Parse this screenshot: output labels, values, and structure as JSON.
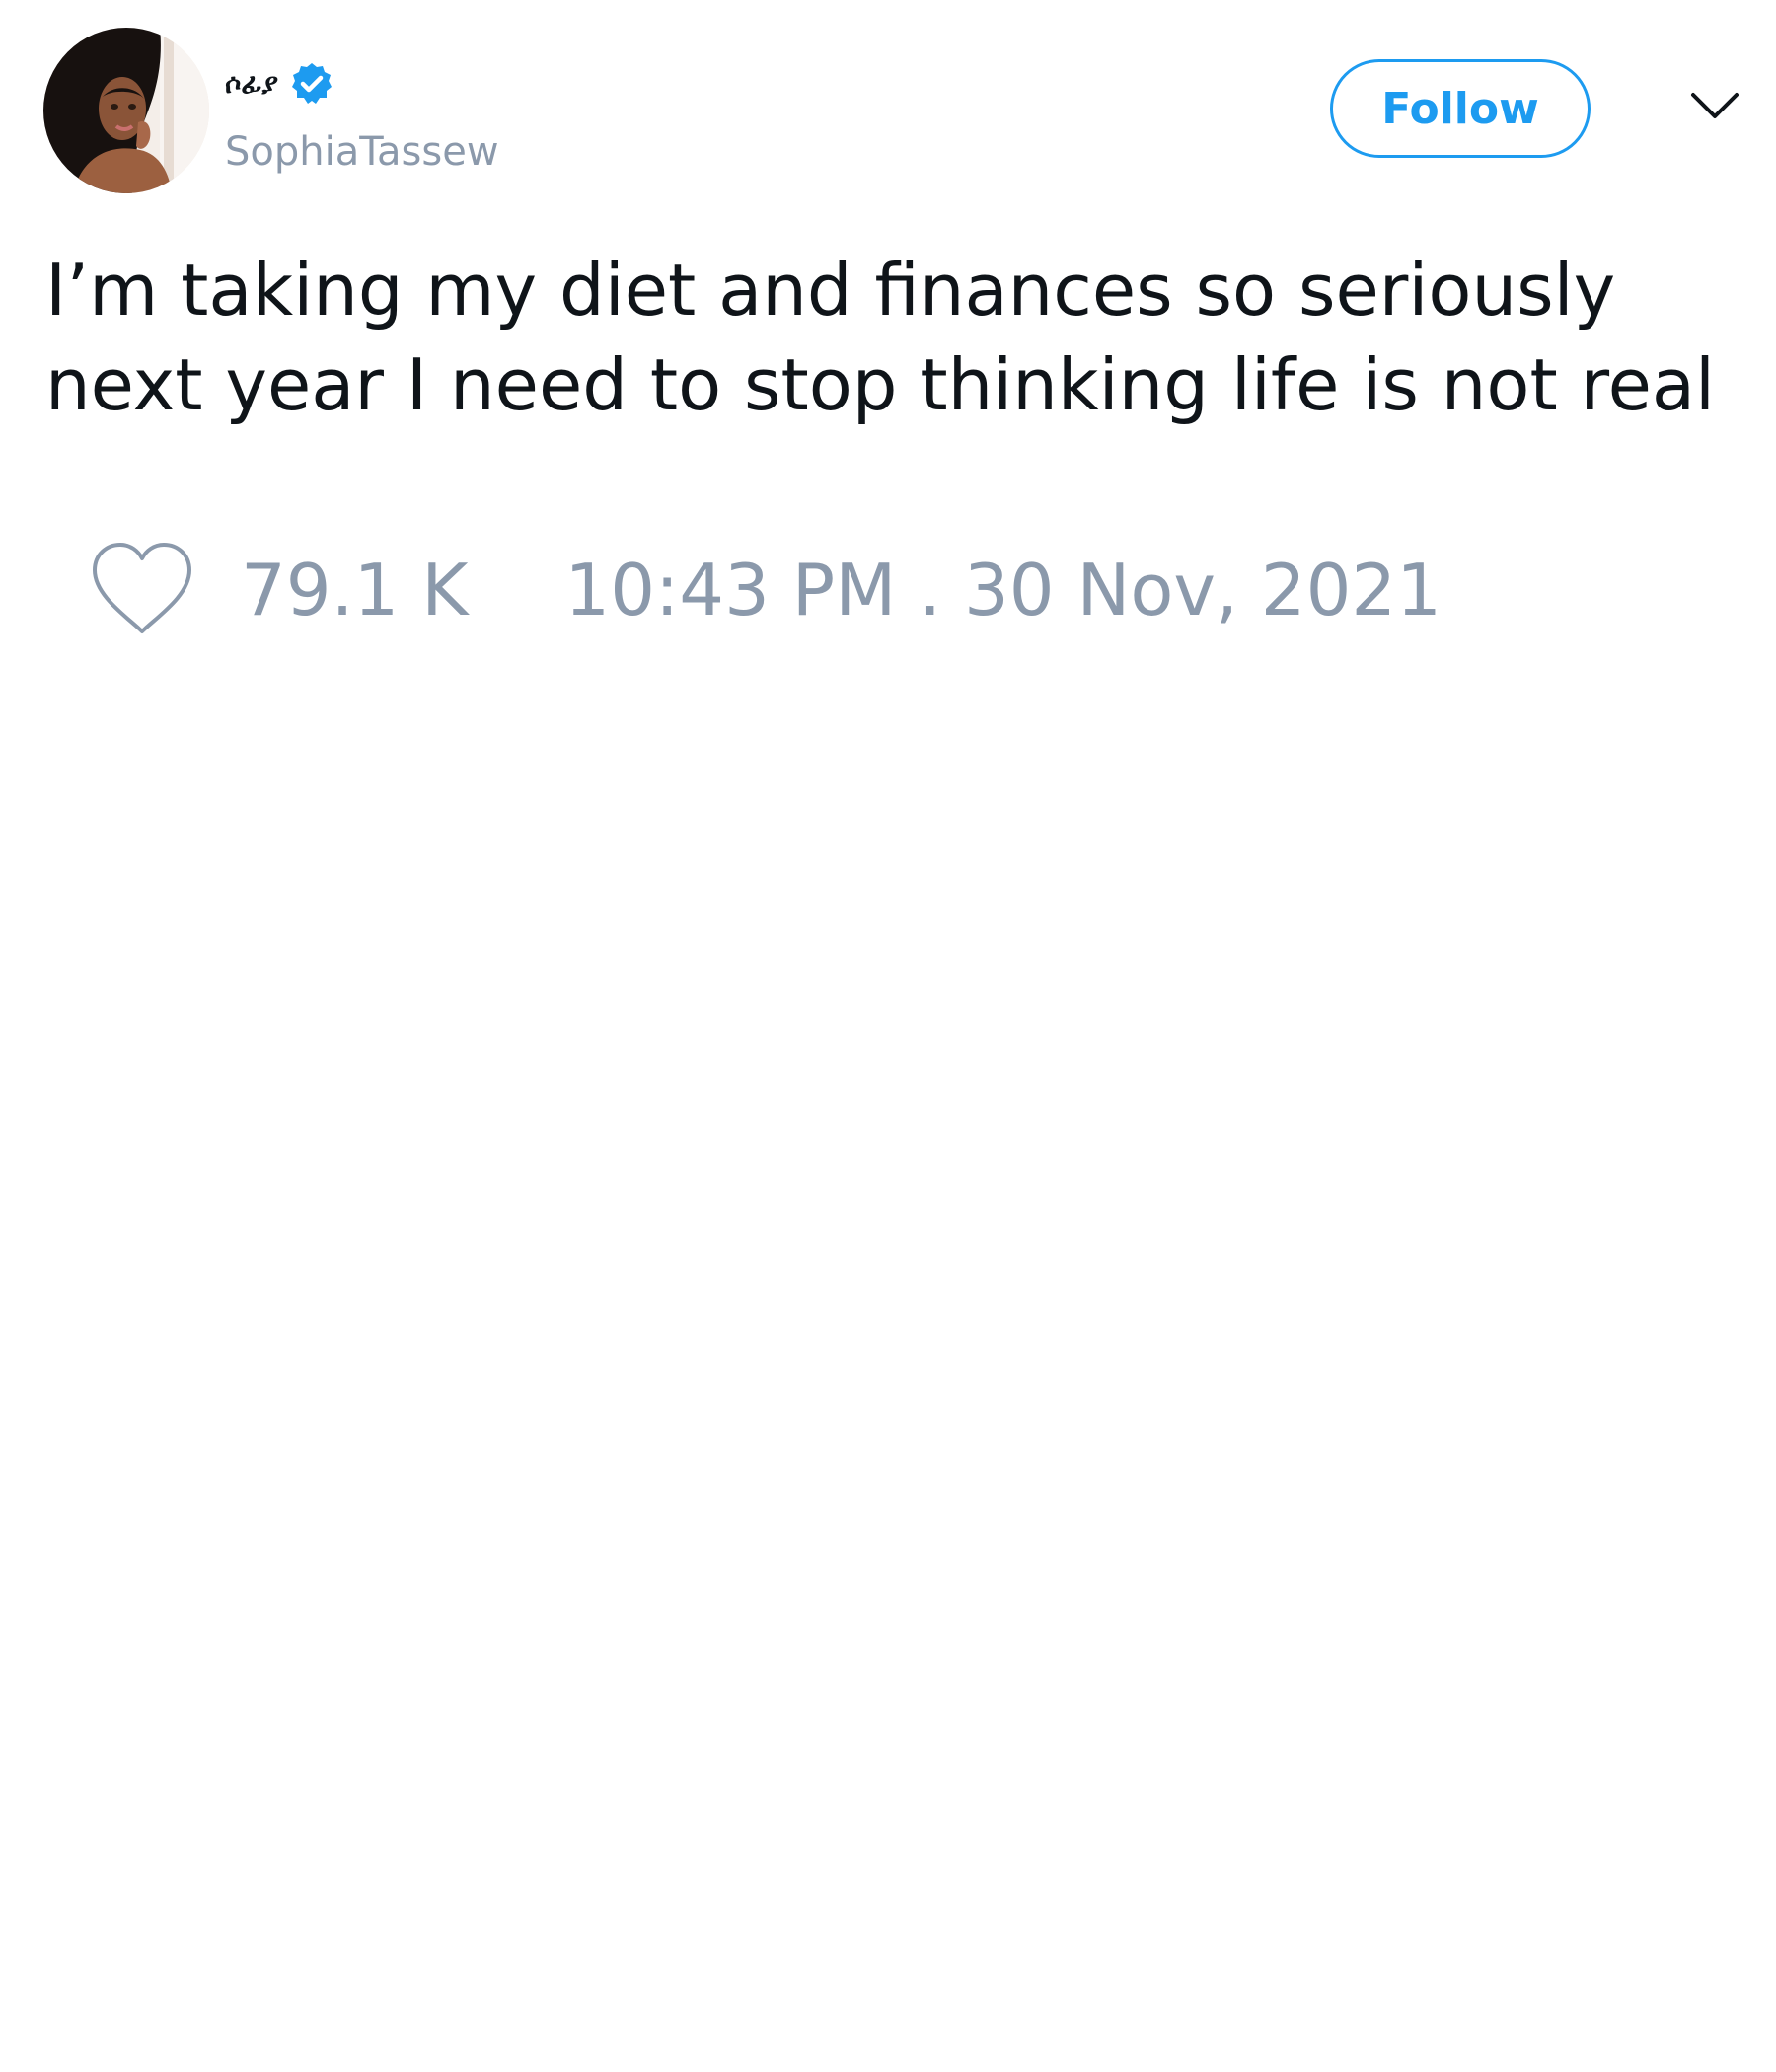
{
  "colors": {
    "accent": "#1d9bf0",
    "muted_text": "#8b99ab",
    "primary_text": "#0f1419",
    "background": "#ffffff"
  },
  "author": {
    "display_name": "ሶፊያ",
    "handle": "SophiaTassew",
    "verified": true,
    "verified_icon": "verified-badge-icon",
    "avatar_icon": "profile-photo"
  },
  "header": {
    "follow_label": "Follow",
    "more_icon": "chevron-down-icon"
  },
  "tweet": {
    "text": "I’m taking my diet and finances so seriously next year I need to stop thinking life is not real"
  },
  "footer": {
    "like_icon": "heart-icon",
    "likes": "79.1 K",
    "timestamp": "10:43 PM . 30 Nov, 2021"
  }
}
